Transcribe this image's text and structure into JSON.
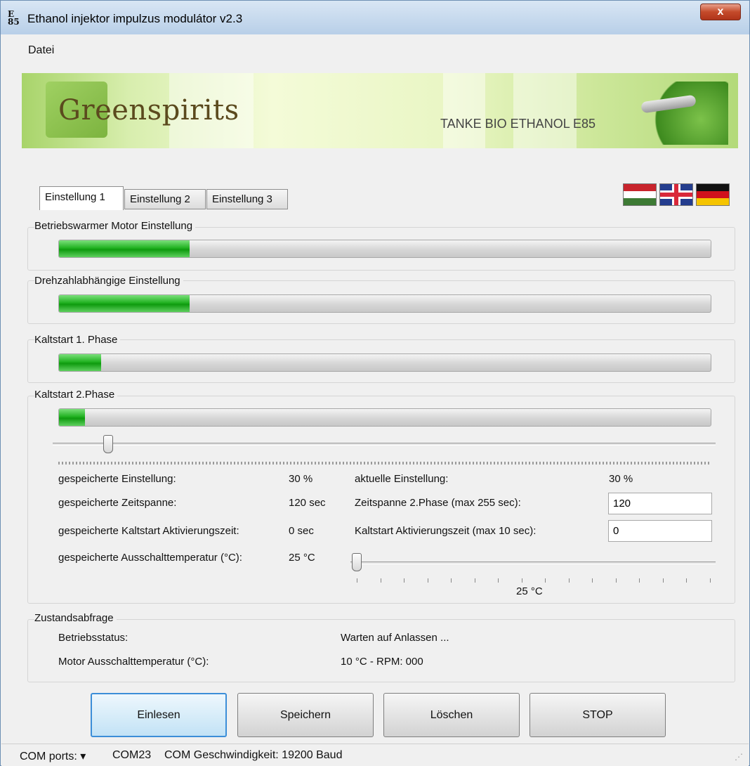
{
  "window": {
    "title": "Ethanol injektor impulzus modulátor v2.3",
    "icon_text_top": "E",
    "icon_text_bottom": "85",
    "close_label": "x"
  },
  "menu": {
    "file_label": "Datei"
  },
  "banner": {
    "logo_text": "Greenspirits",
    "tagline": "TANKE BIO ETHANOL E85"
  },
  "tabs": [
    {
      "label": "Einstellung 1",
      "active": true
    },
    {
      "label": "Einstellung 2",
      "active": false
    },
    {
      "label": "Einstellung 3",
      "active": false
    }
  ],
  "languages": [
    "hungarian-flag",
    "english-flag",
    "german-flag"
  ],
  "settings": [
    {
      "label": "Betriebswarmer Motor Einstellung",
      "progress_fraction": 0.2
    },
    {
      "label": "Drehzahlabhängige Einstellung",
      "progress_fraction": 0.2
    },
    {
      "label": "Kaltstart 1. Phase",
      "progress_fraction": 0.065
    },
    {
      "label": "Kaltstart 2.Phase",
      "progress_fraction": 0.04
    }
  ],
  "phase2": {
    "slider_fraction": 0.04,
    "saved_setting_label": "gespeicherte Einstellung:",
    "saved_setting_value": "30 %",
    "saved_time_label": "gespeicherte Zeitspanne:",
    "saved_time_value": "120 sec",
    "saved_activation_label": "gespeicherte Kaltstart Aktivierungszeit:",
    "saved_activation_value": "0 sec",
    "saved_shutoff_label": "gespeicherte Ausschalttemperatur (°C):",
    "saved_shutoff_value": "25 °C",
    "current_setting_label": "aktuelle Einstellung:",
    "current_setting_value": "30 %",
    "time_input_label": "Zeitspanne 2.Phase (max 255 sec):",
    "time_input_value": "120",
    "activation_input_label": "Kaltstart Aktivierungszeit (max 10 sec):",
    "activation_input_value": "0",
    "temp_slider_fraction": 0.0,
    "temp_value": "25 °C"
  },
  "status": {
    "group_label": "Zustandsabfrage",
    "operating_label": "Betriebsstatus:",
    "operating_value": "Warten auf Anlassen ...",
    "engine_temp_label": "Motor Ausschalttemperatur (°C):",
    "engine_temp_value": "10 °C - RPM: 000"
  },
  "buttons": {
    "read": "Einlesen",
    "save": "Speichern",
    "delete": "Löschen",
    "stop": "STOP"
  },
  "statusbar": {
    "com_ports_label": "COM ports:",
    "port": "COM23",
    "speed": "COM Geschwindigkeit: 19200 Baud"
  }
}
